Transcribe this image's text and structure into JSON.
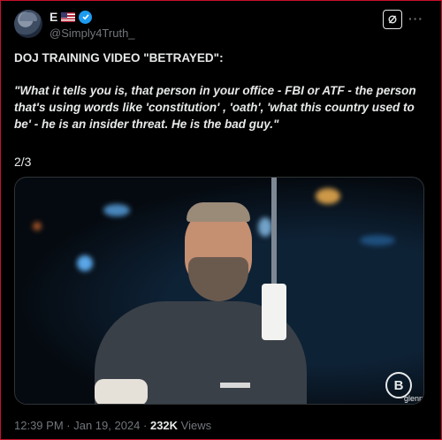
{
  "author": {
    "name": "E",
    "handle": "@Simply4Truth_",
    "avatar_icon": "avatar-image",
    "flag_icon": "us-flag-icon",
    "verified_icon": "verified-badge-icon",
    "verified_color": "#1d9bf0"
  },
  "actions": {
    "grok_icon": "grok-icon",
    "more_label": "···"
  },
  "post": {
    "headline": "DOJ TRAINING VIDEO \"BETRAYED\":",
    "quote": "\"What it tells you is, that person in your office - FBI or ATF  - the person that's using words like 'constitution' , 'oath', 'what this country used to be' - he is an insider threat. He is the bad guy.\"",
    "thread_count": "2/3"
  },
  "media": {
    "logo_letter": "B",
    "logo_text": "glenn"
  },
  "meta": {
    "time": "12:39 PM",
    "separator": " · ",
    "date": "Jan 19, 2024",
    "views_count": "232K",
    "views_label": " Views"
  }
}
